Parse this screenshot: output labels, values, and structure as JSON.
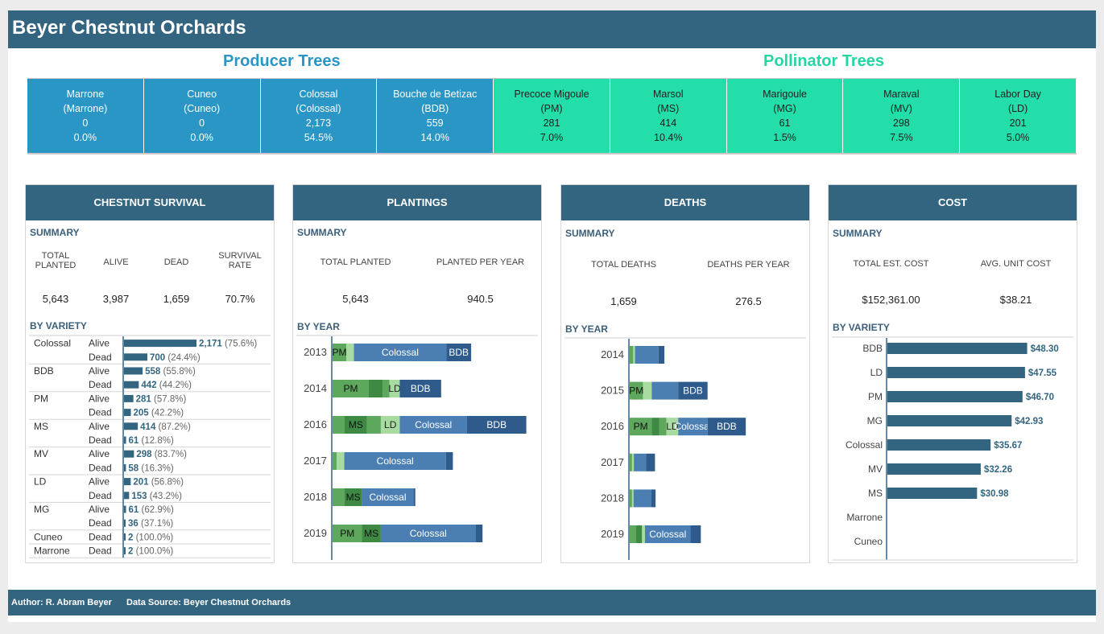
{
  "header": {
    "title": "Beyer Chestnut Orchards"
  },
  "sections": {
    "producer_title": "Producer Trees",
    "pollinator_title": "Pollinator Trees"
  },
  "colors": {
    "header": "#336581",
    "producer": "#2a96c6",
    "pollinator": "#24deaa",
    "bar": "#336581"
  },
  "varieties": [
    {
      "name": "Marrone",
      "code": "(Marrone)",
      "count": "0",
      "pct": "0.0%",
      "group": "producer"
    },
    {
      "name": "Cuneo",
      "code": "(Cuneo)",
      "count": "0",
      "pct": "0.0%",
      "group": "producer"
    },
    {
      "name": "Colossal",
      "code": "(Colossal)",
      "count": "2,173",
      "pct": "54.5%",
      "group": "producer"
    },
    {
      "name": "Bouche de Betizac",
      "code": "(BDB)",
      "count": "559",
      "pct": "14.0%",
      "group": "producer"
    },
    {
      "name": "Precoce Migoule",
      "code": "(PM)",
      "count": "281",
      "pct": "7.0%",
      "group": "pollinator"
    },
    {
      "name": "Marsol",
      "code": "(MS)",
      "count": "414",
      "pct": "10.4%",
      "group": "pollinator"
    },
    {
      "name": "Marigoule",
      "code": "(MG)",
      "count": "61",
      "pct": "1.5%",
      "group": "pollinator"
    },
    {
      "name": "Maraval",
      "code": "(MV)",
      "count": "298",
      "pct": "7.5%",
      "group": "pollinator"
    },
    {
      "name": "Labor Day",
      "code": "(LD)",
      "count": "201",
      "pct": "5.0%",
      "group": "pollinator"
    }
  ],
  "survival": {
    "title": "CHESTNUT SURVIVAL",
    "summary_label": "SUMMARY",
    "metric_labels": [
      "TOTAL PLANTED",
      "ALIVE",
      "DEAD",
      "SURVIVAL RATE"
    ],
    "metric_values": [
      "5,643",
      "3,987",
      "1,659",
      "70.7%"
    ],
    "section_label": "BY VARIETY"
  },
  "plantings": {
    "title": "PLANTINGS",
    "summary_label": "SUMMARY",
    "metric_labels": [
      "TOTAL PLANTED",
      "PLANTED PER YEAR"
    ],
    "metric_values": [
      "5,643",
      "940.5"
    ],
    "section_label": "BY YEAR"
  },
  "deaths": {
    "title": "DEATHS",
    "summary_label": "SUMMARY",
    "metric_labels": [
      "TOTAL DEATHS",
      "DEATHS PER YEAR"
    ],
    "metric_values": [
      "1,659",
      "276.5"
    ],
    "section_label": "BY YEAR"
  },
  "cost": {
    "title": "COST",
    "summary_label": "SUMMARY",
    "metric_labels": [
      "TOTAL EST. COST",
      "AVG. UNIT COST"
    ],
    "metric_values": [
      "$152,361.00",
      "$38.21"
    ],
    "section_label": "BY VARIETY"
  },
  "footer": {
    "author": "Author:  R. Abram Beyer",
    "source": "Data Source:  Beyer Chestnut Orchards"
  },
  "chart_data": [
    {
      "type": "bar",
      "id": "survival",
      "rows": [
        {
          "variety": "Colossal",
          "status": "Alive",
          "value": 2171,
          "label": "2,171",
          "pct": "(75.6%)"
        },
        {
          "variety": "",
          "status": "Dead",
          "value": 700,
          "label": "700",
          "pct": "(24.4%)"
        },
        {
          "variety": "BDB",
          "status": "Alive",
          "value": 558,
          "label": "558",
          "pct": "(55.8%)"
        },
        {
          "variety": "",
          "status": "Dead",
          "value": 442,
          "label": "442",
          "pct": "(44.2%)"
        },
        {
          "variety": "PM",
          "status": "Alive",
          "value": 281,
          "label": "281",
          "pct": "(57.8%)"
        },
        {
          "variety": "",
          "status": "Dead",
          "value": 205,
          "label": "205",
          "pct": "(42.2%)"
        },
        {
          "variety": "MS",
          "status": "Alive",
          "value": 414,
          "label": "414",
          "pct": "(87.2%)"
        },
        {
          "variety": "",
          "status": "Dead",
          "value": 61,
          "label": "61",
          "pct": "(12.8%)"
        },
        {
          "variety": "MV",
          "status": "Alive",
          "value": 298,
          "label": "298",
          "pct": "(83.7%)"
        },
        {
          "variety": "",
          "status": "Dead",
          "value": 58,
          "label": "58",
          "pct": "(16.3%)"
        },
        {
          "variety": "LD",
          "status": "Alive",
          "value": 201,
          "label": "201",
          "pct": "(56.8%)"
        },
        {
          "variety": "",
          "status": "Dead",
          "value": 153,
          "label": "153",
          "pct": "(43.2%)"
        },
        {
          "variety": "MG",
          "status": "Alive",
          "value": 61,
          "label": "61",
          "pct": "(62.9%)"
        },
        {
          "variety": "",
          "status": "Dead",
          "value": 36,
          "label": "36",
          "pct": "(37.1%)"
        },
        {
          "variety": "Cuneo",
          "status": "Dead",
          "value": 2,
          "label": "2",
          "pct": "(100.0%)"
        },
        {
          "variety": "Marrone",
          "status": "Dead",
          "value": 2,
          "label": "2",
          "pct": "(100.0%)"
        }
      ]
    },
    {
      "type": "bar",
      "id": "plantings",
      "stacked": true,
      "categories": [
        "2013",
        "2014",
        "2016",
        "2017",
        "2018",
        "2019"
      ],
      "bars": [
        [
          {
            "label": "PM",
            "value": 40,
            "color": "#5da85d"
          },
          {
            "label": "",
            "value": 22,
            "color": "#a8dba0"
          },
          {
            "label": "Colossal",
            "value": 268,
            "color": "#4b7fb4"
          },
          {
            "label": "BDB",
            "value": 72,
            "color": "#2e5b8c"
          }
        ],
        [
          {
            "label": "PM",
            "value": 105,
            "color": "#5da85d"
          },
          {
            "label": "",
            "value": 40,
            "color": "#3e8a45"
          },
          {
            "label": "",
            "value": 20,
            "color": "#5da85d"
          },
          {
            "label": "LD",
            "value": 30,
            "color": "#a8dba0"
          },
          {
            "label": "BDB",
            "value": 120,
            "color": "#2e5b8c"
          }
        ],
        [
          {
            "label": "",
            "value": 35,
            "color": "#5da85d"
          },
          {
            "label": "MS",
            "value": 65,
            "color": "#3e8a45"
          },
          {
            "label": "",
            "value": 40,
            "color": "#5da85d"
          },
          {
            "label": "LD",
            "value": 55,
            "color": "#a8dba0"
          },
          {
            "label": "Colossal",
            "value": 195,
            "color": "#4b7fb4"
          },
          {
            "label": "BDB",
            "value": 172,
            "color": "#2e5b8c"
          }
        ],
        [
          {
            "label": "",
            "value": 12,
            "color": "#5da85d"
          },
          {
            "label": "",
            "value": 22,
            "color": "#a8dba0"
          },
          {
            "label": "Colossal",
            "value": 295,
            "color": "#4b7fb4"
          },
          {
            "label": "",
            "value": 20,
            "color": "#2e5b8c"
          }
        ],
        [
          {
            "label": "",
            "value": 35,
            "color": "#5da85d"
          },
          {
            "label": "MS",
            "value": 50,
            "color": "#3e8a45"
          },
          {
            "label": "Colossal",
            "value": 150,
            "color": "#4b7fb4"
          },
          {
            "label": "",
            "value": 5,
            "color": "#2e5b8c"
          }
        ],
        [
          {
            "label": "PM",
            "value": 85,
            "color": "#5da85d"
          },
          {
            "label": "MS",
            "value": 55,
            "color": "#3e8a45"
          },
          {
            "label": "Colossal",
            "value": 275,
            "color": "#4b7fb4"
          },
          {
            "label": "",
            "value": 20,
            "color": "#2e5b8c"
          }
        ]
      ],
      "xlim": [
        0,
        570
      ]
    },
    {
      "type": "bar",
      "id": "deaths",
      "stacked": true,
      "categories": [
        "2014",
        "2015",
        "2016",
        "2017",
        "2018",
        "2019"
      ],
      "bars": [
        [
          {
            "label": "",
            "value": 12,
            "color": "#5da85d"
          },
          {
            "label": "",
            "value": 6,
            "color": "#a8dba0"
          },
          {
            "label": "",
            "value": 80,
            "color": "#4b7fb4"
          },
          {
            "label": "",
            "value": 20,
            "color": "#2e5b8c"
          }
        ],
        [
          {
            "label": "PM",
            "value": 45,
            "color": "#5da85d"
          },
          {
            "label": "",
            "value": 30,
            "color": "#a8dba0"
          },
          {
            "label": "",
            "value": 90,
            "color": "#4b7fb4"
          },
          {
            "label": "BDB",
            "value": 100,
            "color": "#2e5b8c"
          }
        ],
        [
          {
            "label": "PM",
            "value": 75,
            "color": "#5da85d"
          },
          {
            "label": "",
            "value": 25,
            "color": "#3e8a45"
          },
          {
            "label": "",
            "value": 25,
            "color": "#5da85d"
          },
          {
            "label": "LD",
            "value": 40,
            "color": "#a8dba0"
          },
          {
            "label": "Colossal",
            "value": 100,
            "color": "#4b7fb4"
          },
          {
            "label": "BDB",
            "value": 130,
            "color": "#2e5b8c"
          }
        ],
        [
          {
            "label": "",
            "value": 8,
            "color": "#5da85d"
          },
          {
            "label": "",
            "value": 6,
            "color": "#a8dba0"
          },
          {
            "label": "",
            "value": 42,
            "color": "#4b7fb4"
          },
          {
            "label": "",
            "value": 30,
            "color": "#2e5b8c"
          }
        ],
        [
          {
            "label": "",
            "value": 8,
            "color": "#5da85d"
          },
          {
            "label": "",
            "value": 5,
            "color": "#a8dba0"
          },
          {
            "label": "",
            "value": 60,
            "color": "#4b7fb4"
          },
          {
            "label": "",
            "value": 15,
            "color": "#2e5b8c"
          }
        ],
        [
          {
            "label": "",
            "value": 22,
            "color": "#5da85d"
          },
          {
            "label": "",
            "value": 20,
            "color": "#3e8a45"
          },
          {
            "label": "",
            "value": 10,
            "color": "#a8dba0"
          },
          {
            "label": "Colossal",
            "value": 155,
            "color": "#4b7fb4"
          },
          {
            "label": "",
            "value": 35,
            "color": "#2e5b8c"
          }
        ]
      ],
      "xlim": [
        0,
        570
      ]
    },
    {
      "type": "bar",
      "id": "cost",
      "categories": [
        "BDB",
        "LD",
        "PM",
        "MG",
        "Colossal",
        "MV",
        "MS",
        "Marrone",
        "Cuneo"
      ],
      "values": [
        48.3,
        47.55,
        46.7,
        42.93,
        35.67,
        32.26,
        30.98,
        null,
        null
      ],
      "labels": [
        "$48.30",
        "$47.55",
        "$46.70",
        "$42.93",
        "$35.67",
        "$32.26",
        "$30.98",
        "",
        ""
      ],
      "xlim": [
        0,
        64
      ]
    }
  ]
}
